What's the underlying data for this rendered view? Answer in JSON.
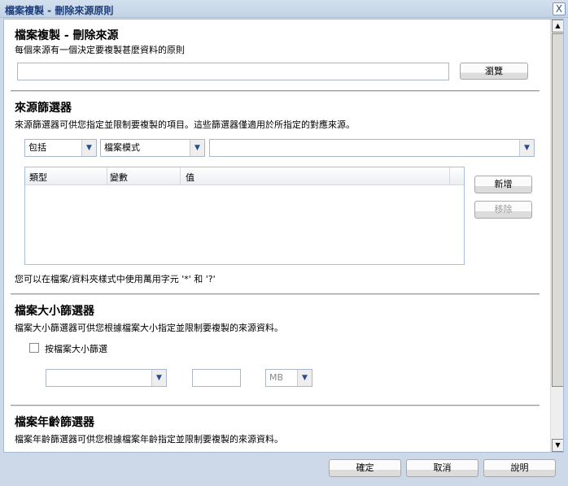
{
  "window": {
    "title": "檔案複製 - 刪除來源原則",
    "close": "X"
  },
  "section1": {
    "title": "檔案複製 - 刪除來源",
    "desc": "每個來源有一個決定要複製甚麼資料的原則",
    "path_value": "",
    "browse": "瀏覽"
  },
  "section2": {
    "title": "來源篩選器",
    "desc": "來源篩選器可供您指定並限制要複製的項目。這些篩選器僅適用於所指定的對應來源。",
    "include": "包括",
    "mode": "檔案模式",
    "pattern": "",
    "columns": [
      "類型",
      "變數",
      "值"
    ],
    "add": "新增",
    "remove": "移除",
    "note": "您可以在檔案/資料夾樣式中使用萬用字元 '*' 和 '?'"
  },
  "section3": {
    "title": "檔案大小篩選器",
    "desc": "檔案大小篩選器可供您根據檔案大小指定並限制要複製的來源資料。",
    "checkbox_label": "按檔案大小篩選",
    "checked": false,
    "operator": "",
    "size": "",
    "unit": "MB"
  },
  "section4": {
    "title": "檔案年齡篩選器",
    "desc": "檔案年齡篩選器可供您根據檔案年齡指定並限制要複製的來源資料。"
  },
  "footer": {
    "ok": "確定",
    "cancel": "取消",
    "help": "說明"
  }
}
